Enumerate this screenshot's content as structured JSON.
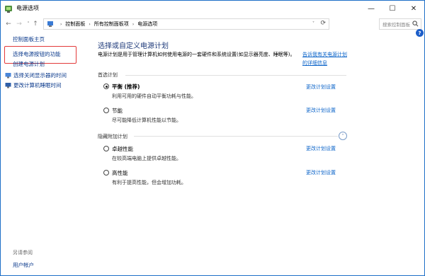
{
  "window": {
    "title": "电源选项",
    "minimize": "—",
    "maximize": "☐",
    "close": "✕"
  },
  "nav": {
    "back": "←",
    "forward": "→",
    "recent": "˅",
    "up": "↑"
  },
  "address": {
    "crumbs": [
      "控制面板",
      "所有控制面板项",
      "电源选项"
    ],
    "separator": "›",
    "dropdown": "˅",
    "refresh": "⟳"
  },
  "search": {
    "placeholder": "搜索控制面板"
  },
  "help": "?",
  "left_pane": {
    "items": [
      {
        "label": "控制面板主页"
      },
      {
        "label": "选择电源按钮的功能"
      },
      {
        "label": "创建电源计划"
      },
      {
        "label": "选择关闭显示器的时间"
      },
      {
        "label": "更改计算机睡眠时间"
      }
    ],
    "see_also": "另请参阅",
    "user_accounts": "用户帐户"
  },
  "main": {
    "heading": "选择或自定义电源计划",
    "description": "电源计划是用于管理计算机如何使用电源的一套硬件和系统设置(如显示器亮度、睡眠等)。",
    "description_link": "告诉我有关电源计划的详细信息",
    "preferred_section": "首选计划",
    "hidden_section": "隐藏附加计划",
    "collapse_icon": "˄",
    "change_link": "更改计划设置",
    "plans": [
      {
        "name": "平衡 (推荐)",
        "desc": "利用可用的硬件自动平衡功耗与性能。",
        "selected": true
      },
      {
        "name": "节能",
        "desc": "尽可能降低计算机性能以节能。",
        "selected": false
      },
      {
        "name": "卓越性能",
        "desc": "在较高端电脑上提供卓越性能。",
        "selected": false
      },
      {
        "name": "高性能",
        "desc": "有利于提高性能，但会增加功耗。",
        "selected": false
      }
    ]
  },
  "colors": {
    "link": "#0a63c9",
    "heading": "#1e3a7a",
    "highlight": "#e33a3a"
  }
}
